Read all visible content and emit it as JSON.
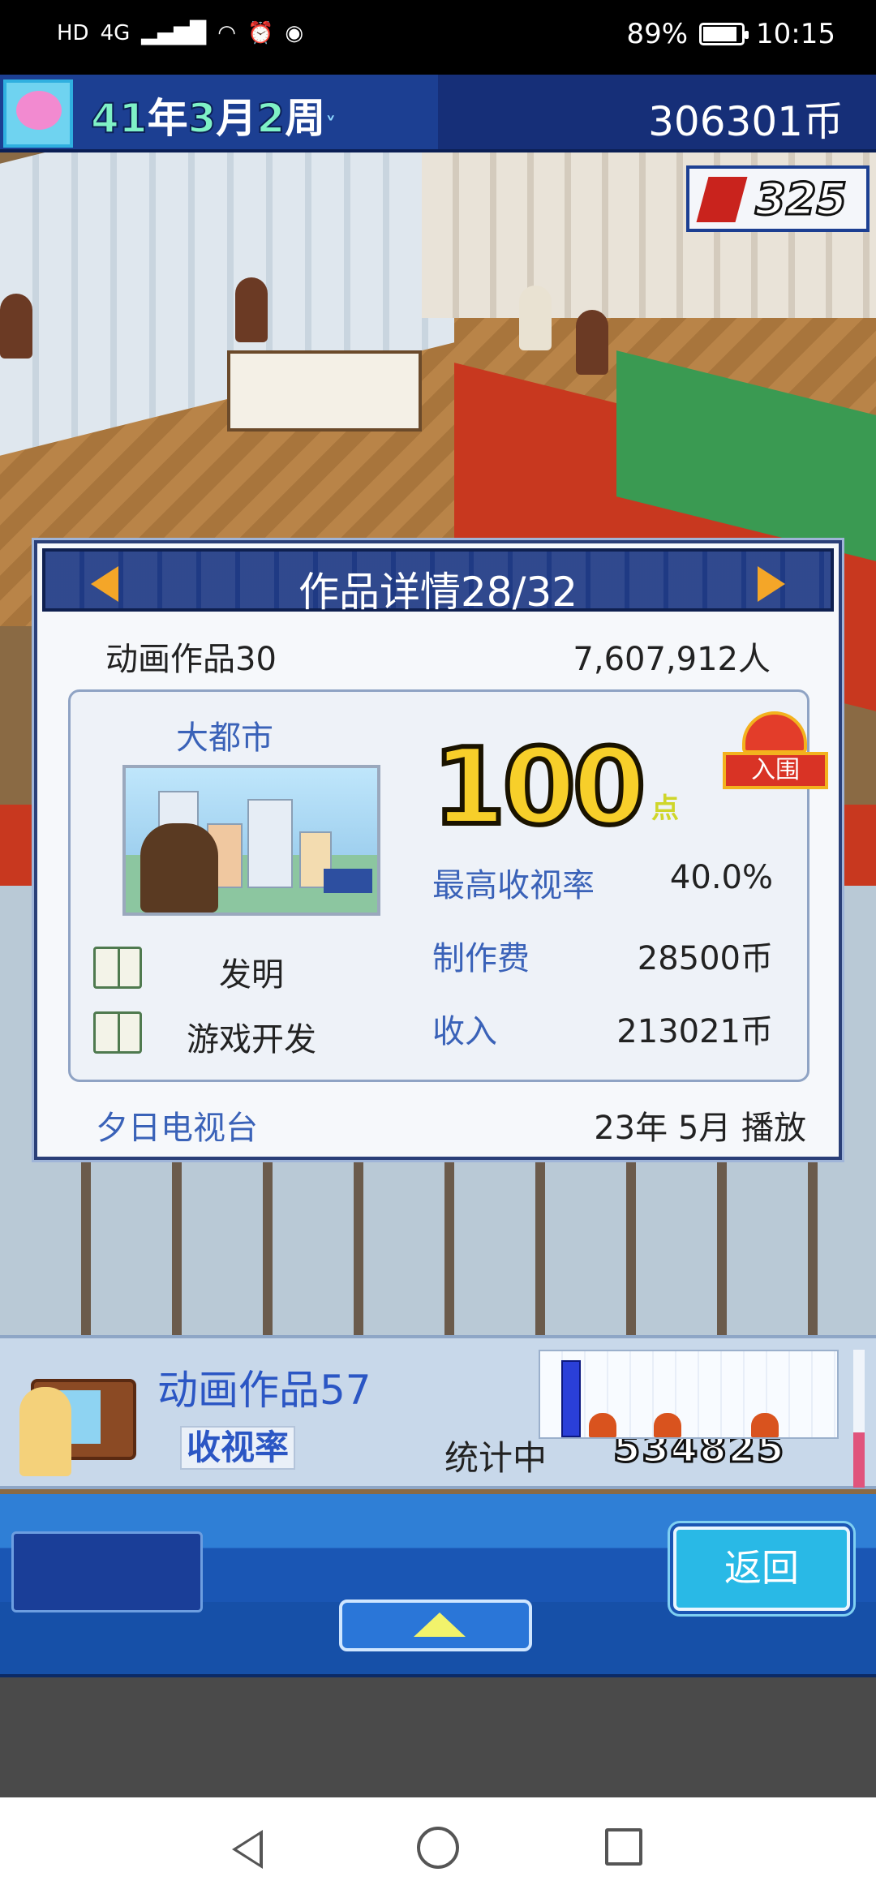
{
  "status_bar": {
    "left_icons": [
      "HD",
      "4G",
      "signal-icon",
      "wifi-icon",
      "alarm-icon",
      "app-icon"
    ],
    "battery": "89%",
    "time": "10:15",
    "battery_level": 0.89
  },
  "hud": {
    "date": {
      "year": "41",
      "year_unit": "年",
      "month": "3",
      "month_unit": "月",
      "week": "2",
      "week_unit": "周"
    },
    "coins": "306301币",
    "books": "325"
  },
  "dialog": {
    "title": "作品详情28/32",
    "work_name": "动画作品30",
    "viewers": "7,607,912人",
    "card": {
      "title": "大都市",
      "score": "100",
      "score_unit": "点",
      "award": "入围",
      "genres": [
        "发明",
        "游戏开发"
      ],
      "stats": [
        {
          "label": "最高收视率",
          "value": "40.0%"
        },
        {
          "label": "制作费",
          "value": "28500币"
        },
        {
          "label": "收入",
          "value": "213021币"
        }
      ]
    },
    "station": "夕日电视台",
    "broadcast": "23年 5月 播放"
  },
  "ratings": {
    "title": "动画作品57",
    "label": "收视率",
    "status": "统计中",
    "count": "534825",
    "chart_bar_level": 0.9,
    "side_level": 0.4
  },
  "controls": {
    "back_label": "返回"
  }
}
